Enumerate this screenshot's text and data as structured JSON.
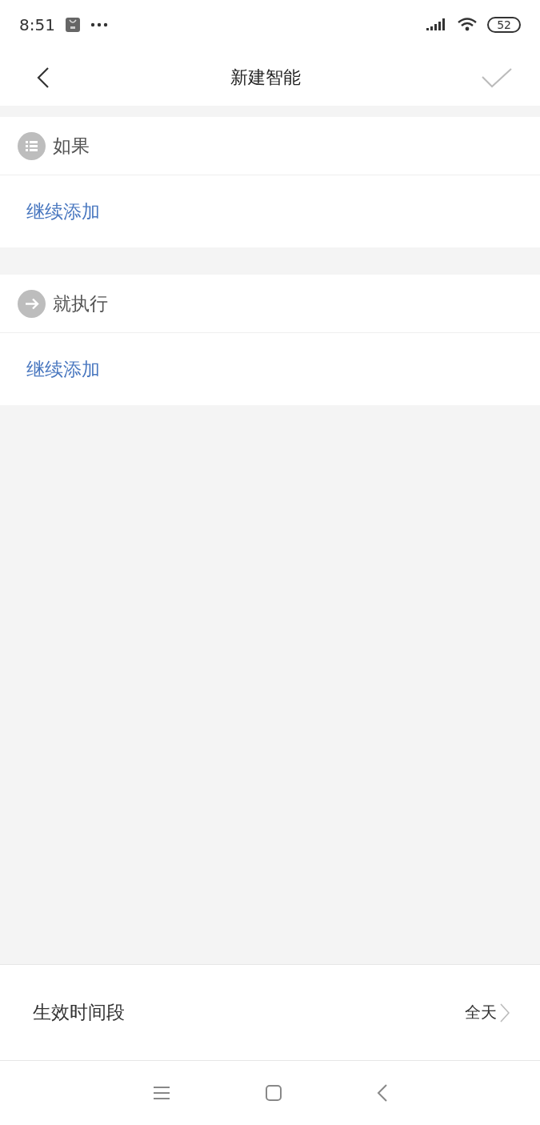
{
  "status_bar": {
    "time": "8:51",
    "battery": "52"
  },
  "header": {
    "title": "新建智能"
  },
  "sections": [
    {
      "kind": "condition",
      "title": "如果",
      "add_label": "继续添加"
    },
    {
      "kind": "action",
      "title": "就执行",
      "add_label": "继续添加"
    }
  ],
  "footer": {
    "label": "生效时间段",
    "value": "全天"
  }
}
